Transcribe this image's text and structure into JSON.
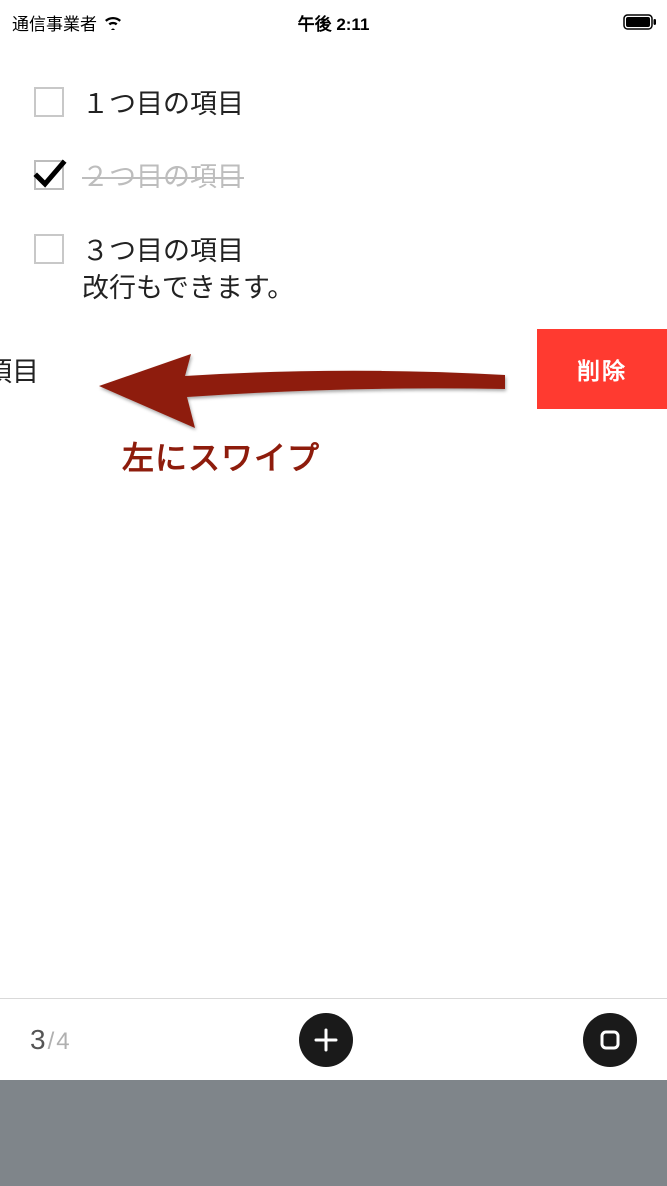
{
  "status_bar": {
    "carrier": "通信事業者",
    "time": "午後 2:11"
  },
  "items": [
    {
      "label": "１つ目の項目",
      "checked": false
    },
    {
      "label": "２つ目の項目",
      "checked": true
    },
    {
      "label": "３つ目の項目\n改行もできます。",
      "checked": false
    }
  ],
  "swiped_item": {
    "partial_label": "つ目の項目",
    "delete_label": "削除"
  },
  "annotation": {
    "label": "左にスワイプ",
    "color": "#8e1c0c"
  },
  "toolbar": {
    "current": "3",
    "separator": " / ",
    "total": "4"
  },
  "icons": {
    "wifi": "wifi-icon",
    "battery": "battery-icon",
    "plus": "plus-icon",
    "square": "square-icon",
    "check": "check-icon"
  }
}
